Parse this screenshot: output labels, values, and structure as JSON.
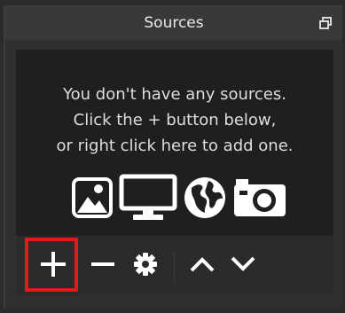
{
  "dock": {
    "title": "Sources",
    "float_icon": "float-icon"
  },
  "empty_state": {
    "lines": [
      "You don't have any sources.",
      "Click the + button below,",
      "or right click here to add one."
    ],
    "icons": [
      "image-icon",
      "monitor-icon",
      "globe-icon",
      "camera-icon"
    ]
  },
  "toolbar": {
    "buttons": [
      "add-icon",
      "remove-icon",
      "properties-gear-icon",
      "move-up-icon",
      "move-down-icon"
    ]
  },
  "colors": {
    "panel": "#2f2f2f",
    "list_bg": "#1f1f1f",
    "highlight": "#e11b1b",
    "text": "#e6e6e6"
  }
}
